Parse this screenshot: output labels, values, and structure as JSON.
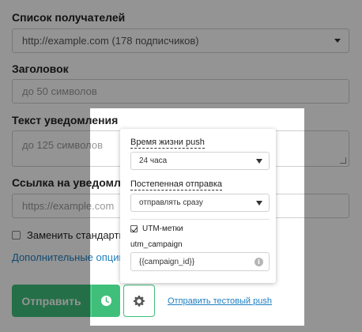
{
  "form": {
    "recipients_label": "Список получателей",
    "recipients_value": "http://example.com (178 подписчиков)",
    "title_label": "Заголовок",
    "title_placeholder": "до 50 символов",
    "text_label": "Текст уведомления",
    "text_placeholder": "до 125 символов",
    "link_label": "Ссылка на уведомлени",
    "link_placeholder": "https://example.com",
    "replace_label": "Заменить стандартнук",
    "more_options": "Дополнительные опции"
  },
  "actions": {
    "send_label": "Отправить",
    "clock_icon": "clock-icon",
    "gear_icon": "gear-icon",
    "test_link": "Отправить тестовый push"
  },
  "popover": {
    "ttl_label": "Время жизни push",
    "ttl_value": "24 часа",
    "gradual_label": "Постепенная отправка",
    "gradual_value": "отправлять сразу",
    "utm_label": "UTM-метки",
    "utm_checked": true,
    "utm_campaign_label": "utm_campaign",
    "utm_campaign_value": "{{campaign_id}}",
    "info_icon": "i"
  },
  "colors": {
    "accent_green": "#3fbf7a",
    "link_blue": "#1e7fc0"
  }
}
